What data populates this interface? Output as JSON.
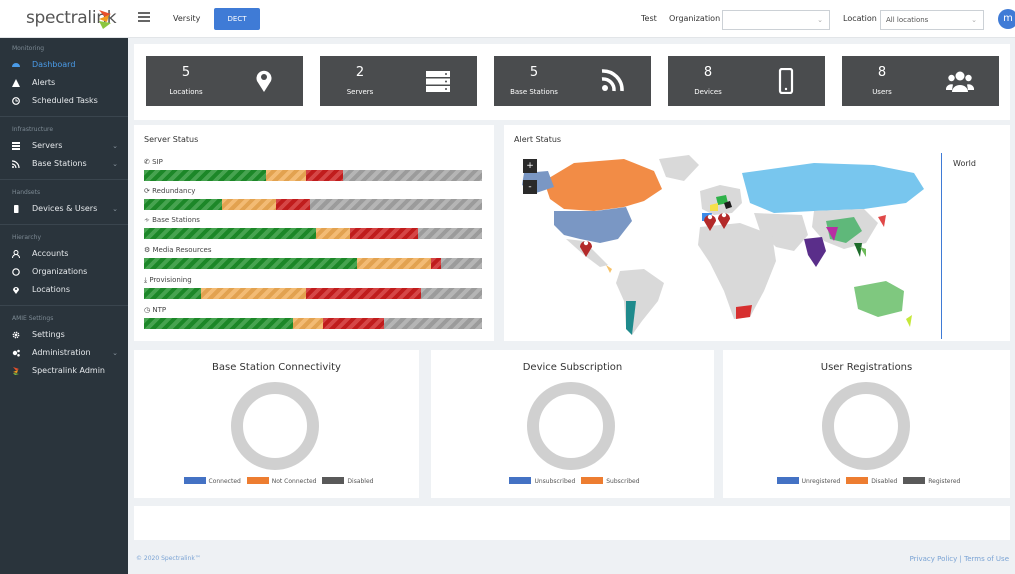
{
  "header": {
    "logo_text": "spectralink",
    "tabs": [
      {
        "label": "Versity"
      },
      {
        "label": "DECT"
      }
    ],
    "test_label": "Test",
    "organization_label": "Organization",
    "organization_value": "",
    "location_label": "Location",
    "location_value": "All locations",
    "avatar_letter": "m"
  },
  "sidebar": {
    "sections": [
      {
        "title": "Monitoring",
        "items": [
          {
            "label": "Dashboard",
            "icon": "dashboard-icon",
            "active": true
          },
          {
            "label": "Alerts",
            "icon": "alert-icon"
          },
          {
            "label": "Scheduled Tasks",
            "icon": "clock-icon"
          }
        ]
      },
      {
        "title": "Infrastructure",
        "items": [
          {
            "label": "Servers",
            "icon": "server-icon",
            "expandable": true
          },
          {
            "label": "Base Stations",
            "icon": "rss-icon",
            "expandable": true
          }
        ]
      },
      {
        "title": "Handsets",
        "items": [
          {
            "label": "Devices & Users",
            "icon": "mobile-icon",
            "expandable": true
          }
        ]
      },
      {
        "title": "Hierarchy",
        "items": [
          {
            "label": "Accounts",
            "icon": "account-icon"
          },
          {
            "label": "Organizations",
            "icon": "organization-icon"
          },
          {
            "label": "Locations",
            "icon": "location-icon"
          }
        ]
      },
      {
        "title": "AMIE Settings",
        "items": [
          {
            "label": "Settings",
            "icon": "gear-icon"
          },
          {
            "label": "Administration",
            "icon": "gears-icon",
            "expandable": true
          },
          {
            "label": "Spectralink Admin",
            "icon": "spectralink-icon"
          }
        ]
      }
    ]
  },
  "stats": [
    {
      "value": "5",
      "label": "Locations",
      "icon": "map-marker-icon"
    },
    {
      "value": "2",
      "label": "Servers",
      "icon": "server-icon"
    },
    {
      "value": "5",
      "label": "Base Stations",
      "icon": "rss-icon"
    },
    {
      "value": "8",
      "label": "Devices",
      "icon": "mobile-icon"
    },
    {
      "value": "8",
      "label": "Users",
      "icon": "users-icon"
    }
  ],
  "server_status": {
    "title": "Server Status",
    "rows": [
      {
        "label": "SIP",
        "icon": "phone-icon",
        "segments": {
          "green": 0.36,
          "orange": 0.12,
          "red": 0.11,
          "gray": 0.41
        }
      },
      {
        "label": "Redundancy",
        "icon": "refresh-icon",
        "segments": {
          "green": 0.23,
          "orange": 0.16,
          "red": 0.1,
          "gray": 0.51
        }
      },
      {
        "label": "Base Stations",
        "icon": "rss-icon",
        "segments": {
          "green": 0.51,
          "orange": 0.1,
          "red": 0.2,
          "gray": 0.19
        }
      },
      {
        "label": "Media Resources",
        "icon": "gears-icon",
        "segments": {
          "green": 0.63,
          "orange": 0.22,
          "red": 0.03,
          "gray": 0.12
        }
      },
      {
        "label": "Provisioning",
        "icon": "download-icon",
        "segments": {
          "green": 0.17,
          "orange": 0.31,
          "red": 0.34,
          "gray": 0.18
        }
      },
      {
        "label": "NTP",
        "icon": "clock-icon",
        "segments": {
          "green": 0.44,
          "orange": 0.09,
          "red": 0.18,
          "gray": 0.29
        }
      }
    ]
  },
  "alert_status": {
    "title": "Alert Status",
    "zoom_in": "+",
    "zoom_out": "-",
    "region_label": "World"
  },
  "donuts": [
    {
      "title": "Base Station Connectivity",
      "legend": [
        {
          "label": "Connected",
          "color": "#4472c4"
        },
        {
          "label": "Not Connected",
          "color": "#ed7d31"
        },
        {
          "label": "Disabled",
          "color": "#595959"
        }
      ]
    },
    {
      "title": "Device Subscription",
      "legend": [
        {
          "label": "Unsubscribed",
          "color": "#4472c4"
        },
        {
          "label": "Subscribed",
          "color": "#ed7d31"
        }
      ]
    },
    {
      "title": "User Registrations",
      "legend": [
        {
          "label": "Unregistered",
          "color": "#4472c4"
        },
        {
          "label": "Disabled",
          "color": "#ed7d31"
        },
        {
          "label": "Registered",
          "color": "#595959"
        }
      ]
    }
  ],
  "footer": {
    "copyright": "© 2020 Spectralink™",
    "privacy": "Privacy Policy",
    "separator": " | ",
    "terms": "Terms of Use"
  }
}
